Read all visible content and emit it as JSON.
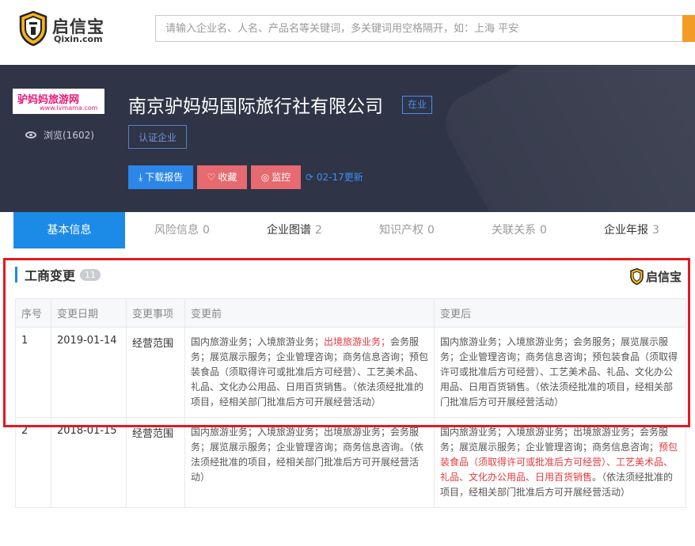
{
  "brand": {
    "name": "启信宝",
    "domain": "Qixin.com"
  },
  "search": {
    "placeholder": "请输入企业名、人名、产品名等关键词，多关键词用空格隔开，如：上海 平安"
  },
  "company": {
    "logo_text": "驴妈妈旅游网",
    "logo_url_text": "www.lvmama.com",
    "name": "南京驴妈妈国际旅行社有限公司",
    "status": "在业",
    "views": "浏览(1602)",
    "verify_label": "认证企业",
    "download_label": "下载报告",
    "favorite_label": "收藏",
    "monitor_label": "监控",
    "update_label": "02-17更新"
  },
  "tabs": [
    {
      "label": "基本信息",
      "count": ""
    },
    {
      "label": "风险信息",
      "count": "0"
    },
    {
      "label": "企业图谱",
      "count": "2"
    },
    {
      "label": "知识产权",
      "count": "0"
    },
    {
      "label": "关联关系",
      "count": "0"
    },
    {
      "label": "企业年报",
      "count": "3"
    }
  ],
  "section": {
    "title": "工商变更",
    "count": "11",
    "watermark": "启信宝"
  },
  "table": {
    "headers": [
      "序号",
      "变更日期",
      "变更事项",
      "变更前",
      "变更后"
    ],
    "rows": [
      {
        "no": "1",
        "date": "2019-01-14",
        "item": "经营范围",
        "before": [
          {
            "text": "国内旅游业务；入境旅游业务；",
            "hl": false
          },
          {
            "text": "出境旅游业务；",
            "hl": true
          },
          {
            "text": "会务服务；展览展示服务；企业管理咨询；商务信息咨询；预包装食品（须取得许可或批准后方可经营）、工艺美术品、礼品、文化办公用品、日用百货销售。（依法须经批准的项目，经相关部门批准后方可开展经营活动）",
            "hl": false
          }
        ],
        "after": [
          {
            "text": "国内旅游业务；入境旅游业务；会务服务；展览展示服务；企业管理咨询；商务信息咨询；预包装食品（须取得许可或批准后方可经营）、工艺美术品、礼品、文化办公用品、日用百货销售。（依法须经批准的项目，经相关部门批准后方可开展经营活动）",
            "hl": false
          }
        ]
      },
      {
        "no": "2",
        "date": "2018-01-15",
        "item": "经营范围",
        "before": [
          {
            "text": "国内旅游业务；入境旅游业务；出境旅游业务；会务服务；展览展示服务；企业管理咨询；商务信息咨询。（依法须经批准的项目，经相关部门批准后方可开展经营活动）",
            "hl": false
          }
        ],
        "after": [
          {
            "text": "国内旅游业务；入境旅游业务；出境旅游业务；会务服务；展览展示服务；企业管理咨询；商务信息咨询；",
            "hl": false
          },
          {
            "text": "预包装食品（须取得许可或批准后方可经营）、工艺美术品、礼品、文化办公用品、日用百货销售",
            "hl": true
          },
          {
            "text": "。（依法须经批准的项目，经相关部门批准后方可开展经营活动）",
            "hl": false
          }
        ]
      }
    ]
  },
  "colors": {
    "accent": "#1c8be8",
    "highlight": "#e4393c",
    "header_bg": "#2f3446",
    "search_button": "#f39b27"
  }
}
